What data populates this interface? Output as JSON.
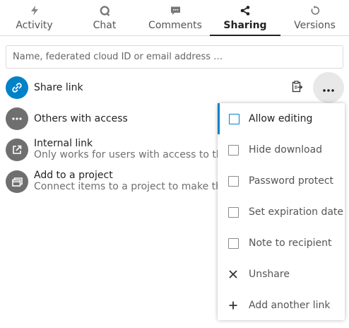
{
  "tabs": [
    {
      "label": "Activity",
      "icon": "activity-icon",
      "active": false
    },
    {
      "label": "Chat",
      "icon": "chat-icon",
      "active": false
    },
    {
      "label": "Comments",
      "icon": "comments-icon",
      "active": false
    },
    {
      "label": "Sharing",
      "icon": "share-icon",
      "active": true
    },
    {
      "label": "Versions",
      "icon": "history-icon",
      "active": false
    }
  ],
  "search": {
    "placeholder": "Name, federated cloud ID or email address …",
    "value": ""
  },
  "shares": {
    "share_link": {
      "title": "Share link",
      "icon": "link-icon"
    },
    "others": {
      "title": "Others with access",
      "icon": "ellipsis-icon"
    },
    "internal": {
      "title": "Internal link",
      "subtitle": "Only works for users with access to this fi",
      "icon": "external-link-icon"
    },
    "project": {
      "title": "Add to a project",
      "subtitle": "Connect items to a project to make them",
      "icon": "project-icon"
    }
  },
  "actions": {
    "copy_icon": "clipboard-icon",
    "more_icon": "more-icon"
  },
  "menu": {
    "items": [
      {
        "label": "Allow editing",
        "type": "checkbox",
        "checked": false,
        "focused": true
      },
      {
        "label": "Hide download",
        "type": "checkbox",
        "checked": false
      },
      {
        "label": "Password protect",
        "type": "checkbox",
        "checked": false
      },
      {
        "label": "Set expiration date",
        "type": "checkbox",
        "checked": false
      },
      {
        "label": "Note to recipient",
        "type": "checkbox",
        "checked": false
      },
      {
        "label": "Unshare",
        "type": "action",
        "icon": "close-icon"
      },
      {
        "label": "Add another link",
        "type": "action",
        "icon": "plus-icon"
      }
    ]
  },
  "colors": {
    "accent": "#0082c9",
    "avatar_grey": "#6f6f6f",
    "text": "#222222",
    "muted_text": "#707070"
  }
}
